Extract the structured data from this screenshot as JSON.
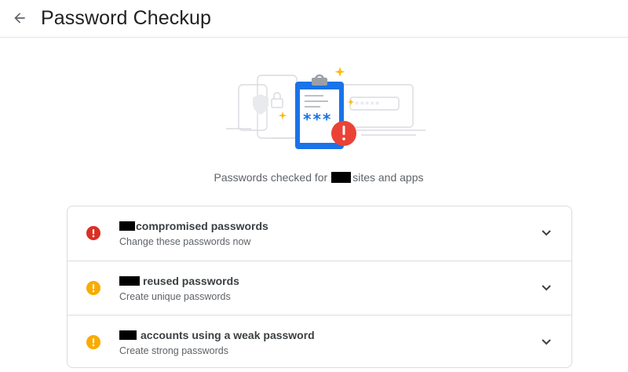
{
  "header": {
    "title": "Password Checkup",
    "back_icon": "arrow-back-icon"
  },
  "summary": {
    "prefix": "Passwords checked for",
    "suffix": "sites and apps"
  },
  "colors": {
    "red": "#d93025",
    "yellow": "#f9ab00",
    "blue": "#1a73e8",
    "gold": "#fbbc04"
  },
  "items": [
    {
      "title": "compromised passwords",
      "subtitle": "Change these passwords now",
      "severity": "red",
      "icon": "error-icon"
    },
    {
      "title": "reused passwords",
      "subtitle": "Create unique passwords",
      "severity": "yellow",
      "icon": "warning-icon"
    },
    {
      "title": "accounts using a weak password",
      "subtitle": "Create strong passwords",
      "severity": "yellow",
      "icon": "warning-icon"
    }
  ],
  "illustration": {
    "clipboard_text": "***",
    "field_text": "*****"
  }
}
